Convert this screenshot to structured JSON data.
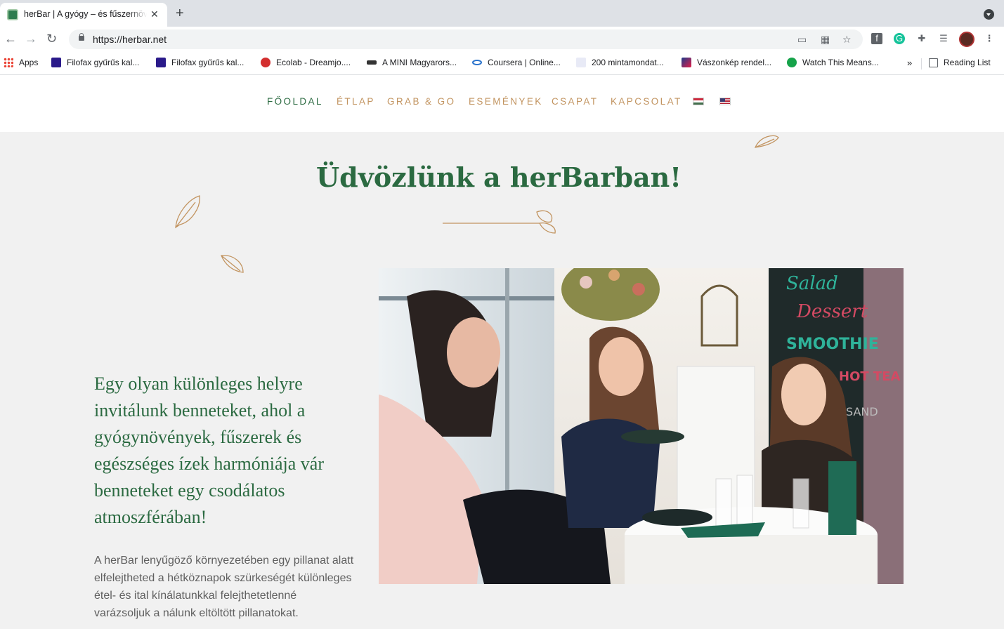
{
  "browser": {
    "tab_title": "herBar | A gyógy – és fűszernövény bár",
    "url": "https://herbar.net",
    "bookmarks": [
      {
        "label": "Apps",
        "icon": "apps-grid-icon"
      },
      {
        "label": "Filofax gyűrűs kal...",
        "icon": "filofax-icon"
      },
      {
        "label": "Filofax gyűrűs kal...",
        "icon": "filofax-icon"
      },
      {
        "label": "Ecolab - Dreamjo....",
        "icon": "ecolab-icon"
      },
      {
        "label": "A MINI Magyarors...",
        "icon": "mini-icon"
      },
      {
        "label": "Coursera | Online...",
        "icon": "coursera-icon"
      },
      {
        "label": "200 mintamondat...",
        "icon": "page-icon"
      },
      {
        "label": "Vászonkép rendel...",
        "icon": "vaszonkep-icon"
      },
      {
        "label": "Watch This Means...",
        "icon": "dollar-icon"
      }
    ],
    "more_bookmarks": "»",
    "reading_list": "Reading List"
  },
  "nav": {
    "items": [
      "FŐOLDAL",
      "ÉTLAP",
      "GRAB & GO",
      "ESEMÉNYEK",
      "CSAPAT",
      "KAPCSOLAT"
    ],
    "active_index": 0
  },
  "hero": {
    "title": "Üdvözlünk a herBarban!"
  },
  "intro": "Egy olyan különleges helyre invitálunk benneteket, ahol a gyógynövények, fűszerek és egészséges ízek harmóniája vár benneteket egy csodálatos atmoszférában!",
  "body": "A herBar lenyűgöző környezetében egy pillanat alatt elfelejtheted a hétköznapok szürkeségét különleges étel- és ital kínálatunkkal felejthetetlenné varázsoljuk a nálunk eltöltött pillanatokat.",
  "photo": {
    "chalkboard": [
      "Salad",
      "Dessert",
      "SMOOTHIE",
      "HOT TEA",
      "SAND"
    ]
  },
  "colors": {
    "brand_green": "#2b6a41",
    "accent_gold": "#c29460",
    "background": "#f1f1f1"
  }
}
